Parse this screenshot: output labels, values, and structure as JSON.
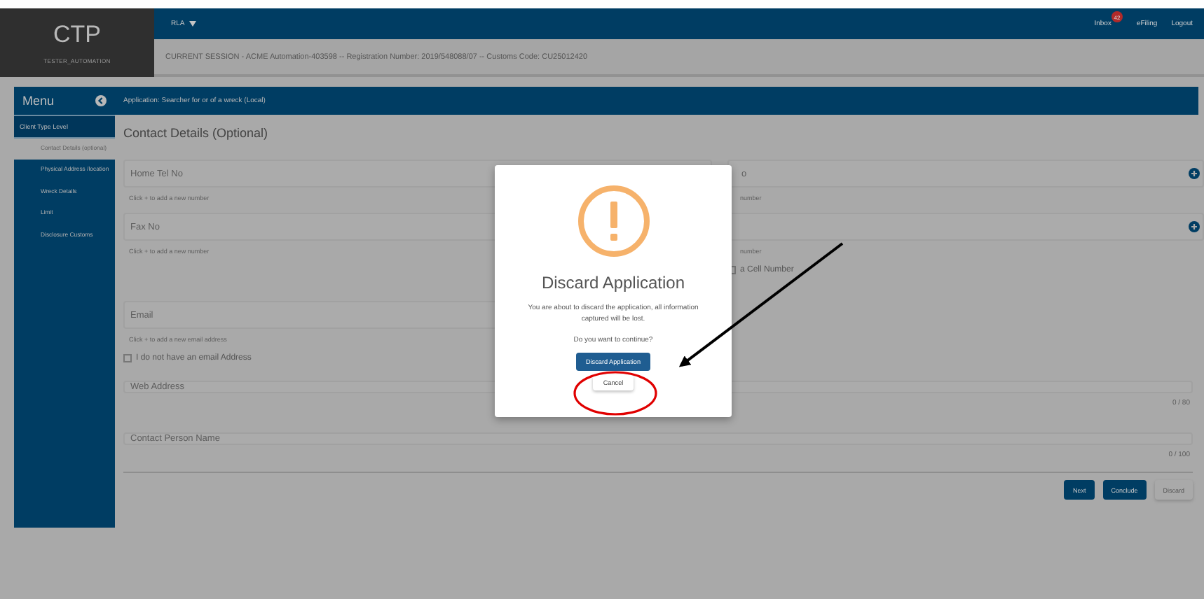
{
  "header": {
    "logo": "CTP",
    "username": "TESTER_AUTOMATION",
    "nav_menu": "RLA",
    "links": [
      {
        "label": "Inbox",
        "badge": "42"
      },
      {
        "label": "eFiling"
      },
      {
        "label": "Logout"
      }
    ],
    "session": "CURRENT SESSION - ACME Automation-403598 -- Registration Number: 2019/548088/07 -- Customs Code: CU25012420"
  },
  "menu": {
    "title": "Menu",
    "section": "Client Type Level",
    "items": [
      {
        "label": "Contact Details (optional)",
        "selected": true
      },
      {
        "label": "Physical Address /location",
        "selected": false
      },
      {
        "label": "Wreck Details",
        "selected": false
      },
      {
        "label": "Limit",
        "selected": false
      },
      {
        "label": "Disclosure Customs",
        "selected": false
      }
    ]
  },
  "application_bar": "Application: Searcher for or of a wreck (Local)",
  "page_title": "Contact Details (Optional)",
  "phone_rows": [
    {
      "left": {
        "placeholder": "Home Tel No",
        "hint": "Click + to add a new number"
      },
      "right": {
        "placeholder": "o",
        "hint": "number"
      }
    },
    {
      "left": {
        "placeholder": "Fax No",
        "hint": "Click + to add a new number"
      },
      "right": {
        "hint": "number",
        "checkbox": {
          "label": "a Cell Number",
          "checked": false
        }
      }
    }
  ],
  "email": {
    "placeholder": "Email",
    "hint": "Click + to add a new email address",
    "checkbox": {
      "label": "I do not have an email Address",
      "checked": false
    }
  },
  "wide_fields": [
    {
      "placeholder": "Web Address",
      "counter": "0 / 80"
    },
    {
      "placeholder": "Contact Person Name",
      "counter": "0 / 100"
    }
  ],
  "buttons": [
    {
      "label": "Next",
      "kind": "primary"
    },
    {
      "label": "Conclude",
      "kind": "primary"
    },
    {
      "label": "Discard",
      "kind": "plain"
    }
  ],
  "dialog": {
    "title": "Discard Application",
    "message": "You are about to discard the application, all information captured will be lost.",
    "question": "Do you want to continue?",
    "confirm": "Discard Application",
    "cancel": "Cancel"
  }
}
